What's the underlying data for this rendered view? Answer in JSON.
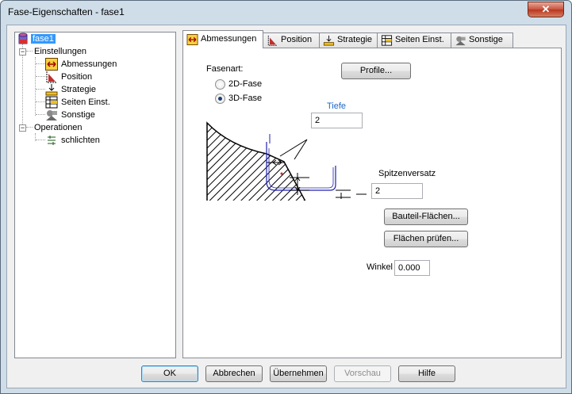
{
  "window": {
    "title": "Fase-Eigenschaften - fase1",
    "close_glyph": "✕"
  },
  "tree": {
    "root": "fase1",
    "settings": "Einstellungen",
    "settings_items": [
      "Abmessungen",
      "Position",
      "Strategie",
      "Seiten Einst.",
      "Sonstige"
    ],
    "operations": "Operationen",
    "operations_items": [
      "schlichten"
    ],
    "expander": "−"
  },
  "tabs": [
    {
      "label": "Abmessungen",
      "icon": "dimensions-icon"
    },
    {
      "label": "Position",
      "icon": "position-icon"
    },
    {
      "label": "Strategie",
      "icon": "strategy-icon"
    },
    {
      "label": "Seiten Einst.",
      "icon": "side-settings-icon"
    },
    {
      "label": "Sonstige",
      "icon": "misc-icon"
    }
  ],
  "form": {
    "chamfer_type_label": "Fasenart:",
    "profiles_button": "Profile...",
    "radio_2d": "2D-Fase",
    "radio_3d": "3D-Fase",
    "selected_type": "3D-Fase",
    "depth_label": "Tiefe",
    "depth_value": "2",
    "tip_offset_label": "Spitzenversatz",
    "tip_offset_value": "2",
    "part_surfaces_button": "Bauteil-Flächen...",
    "check_surfaces_button": "Flächen prüfen...",
    "angle_label": "Winkel",
    "angle_value": "0.000"
  },
  "buttons": {
    "ok": "OK",
    "cancel": "Abbrechen",
    "apply": "Übernehmen",
    "preview": "Vorschau",
    "help": "Hilfe"
  },
  "colors": {
    "accent_blue": "#1e66c8",
    "selection": "#3399ff",
    "tiefe_label": "#1e66c8"
  }
}
